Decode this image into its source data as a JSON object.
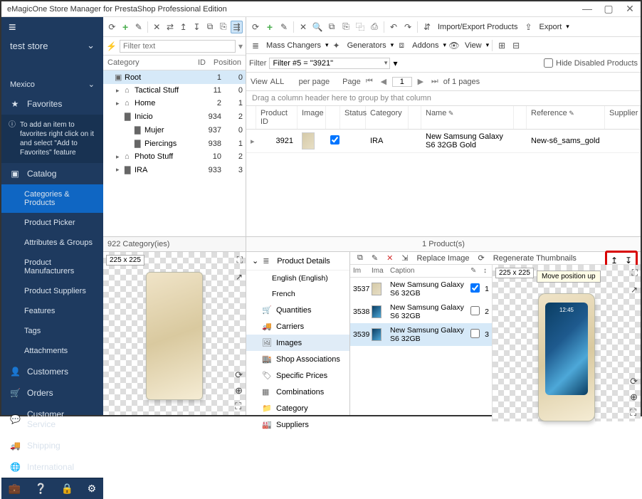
{
  "app_title": "eMagicOne Store Manager for PrestaShop Professional Edition",
  "window": {
    "min": "—",
    "max": "▢",
    "close": "✕"
  },
  "sidebar": {
    "store": "test store",
    "region": "Mexico",
    "favorites": "Favorites",
    "fav_hint": "To add an item to favorites right click on it and select \"Add to Favorites\" feature",
    "catalog": "Catalog",
    "items": [
      "Categories & Products",
      "Product Picker",
      "Attributes & Groups",
      "Product Manufacturers",
      "Product Suppliers",
      "Features",
      "Tags",
      "Attachments"
    ],
    "customers": "Customers",
    "orders": "Orders",
    "customer_service": "Customer Service",
    "shipping": "Shipping",
    "international": "International"
  },
  "cat_toolbar": {
    "filter_ph": "Filter text"
  },
  "cat_columns": {
    "c1": "Category",
    "c2": "ID",
    "c3": "Position"
  },
  "cat_tree": [
    {
      "name": "Root",
      "id": "1",
      "pos": "0",
      "lvl": 0,
      "exp": "",
      "ic": "▣",
      "sel": true
    },
    {
      "name": "Tactical Stuff",
      "id": "11",
      "pos": "0",
      "lvl": 1,
      "exp": "▸",
      "ic": "⌂"
    },
    {
      "name": "Home",
      "id": "2",
      "pos": "1",
      "lvl": 1,
      "exp": "▸",
      "ic": "⌂"
    },
    {
      "name": "Inicio",
      "id": "934",
      "pos": "2",
      "lvl": 1,
      "exp": "",
      "ic": "▇"
    },
    {
      "name": "Mujer",
      "id": "937",
      "pos": "0",
      "lvl": 2,
      "exp": "",
      "ic": "▇"
    },
    {
      "name": "Piercings",
      "id": "938",
      "pos": "1",
      "lvl": 2,
      "exp": "",
      "ic": "▇"
    },
    {
      "name": "Photo Stuff",
      "id": "10",
      "pos": "2",
      "lvl": 1,
      "exp": "▸",
      "ic": "⌂"
    },
    {
      "name": "IRA",
      "id": "933",
      "pos": "3",
      "lvl": 1,
      "exp": "▸",
      "ic": "▇"
    }
  ],
  "cat_footer": "922 Category(ies)",
  "prod_toolbar": {
    "import_export": "Import/Export Products",
    "export": "Export",
    "mass": "Mass Changers",
    "gen": "Generators",
    "addons": "Addons",
    "view": "View"
  },
  "filter": {
    "label": "Filter",
    "value": "Filter #5 = \"3921\"",
    "hide": "Hide Disabled Products"
  },
  "pager": {
    "view": "View",
    "all": "ALL",
    "pp": "per page",
    "page": "Page",
    "num": "1",
    "of": "of 1 pages"
  },
  "group_hint": "Drag a column header here to group by that column",
  "prod_cols": [
    "",
    "Product ID",
    "Image",
    "",
    "Status",
    "Category",
    "",
    "Name",
    "",
    "Reference",
    "Supplier"
  ],
  "prod_row": {
    "id": "3921",
    "status_checked": true,
    "cat": "IRA",
    "name": "New Samsung Galaxy S6 32GB Gold",
    "ref": "New-s6_sams_gold"
  },
  "prod_footer": "1 Product(s)",
  "preview_badge": "225 x 225",
  "details": {
    "header": "Product Details",
    "lang_en": "English (English)",
    "lang_fr": "French",
    "items": [
      "Quantities",
      "Carriers",
      "Images",
      "Shop Associations",
      "Specific Prices",
      "Combinations",
      "Category",
      "Suppliers"
    ]
  },
  "img_toolbar": {
    "replace": "Replace Image",
    "regen": "Regenerate Thumbnails",
    "tooltip": "Move position up"
  },
  "img_cols": [
    "Im",
    "Ima",
    "Caption",
    "",
    ""
  ],
  "img_rows": [
    {
      "id": "3537",
      "cap": "New Samsung Galaxy S6 32GB",
      "chk": true,
      "n": "1",
      "gold": true
    },
    {
      "id": "3538",
      "cap": "New Samsung Galaxy S6 32GB",
      "chk": false,
      "n": "2",
      "gold": false
    },
    {
      "id": "3539",
      "cap": "New Samsung Galaxy S6 32GB",
      "chk": false,
      "n": "3",
      "gold": false,
      "sel": true
    }
  ]
}
